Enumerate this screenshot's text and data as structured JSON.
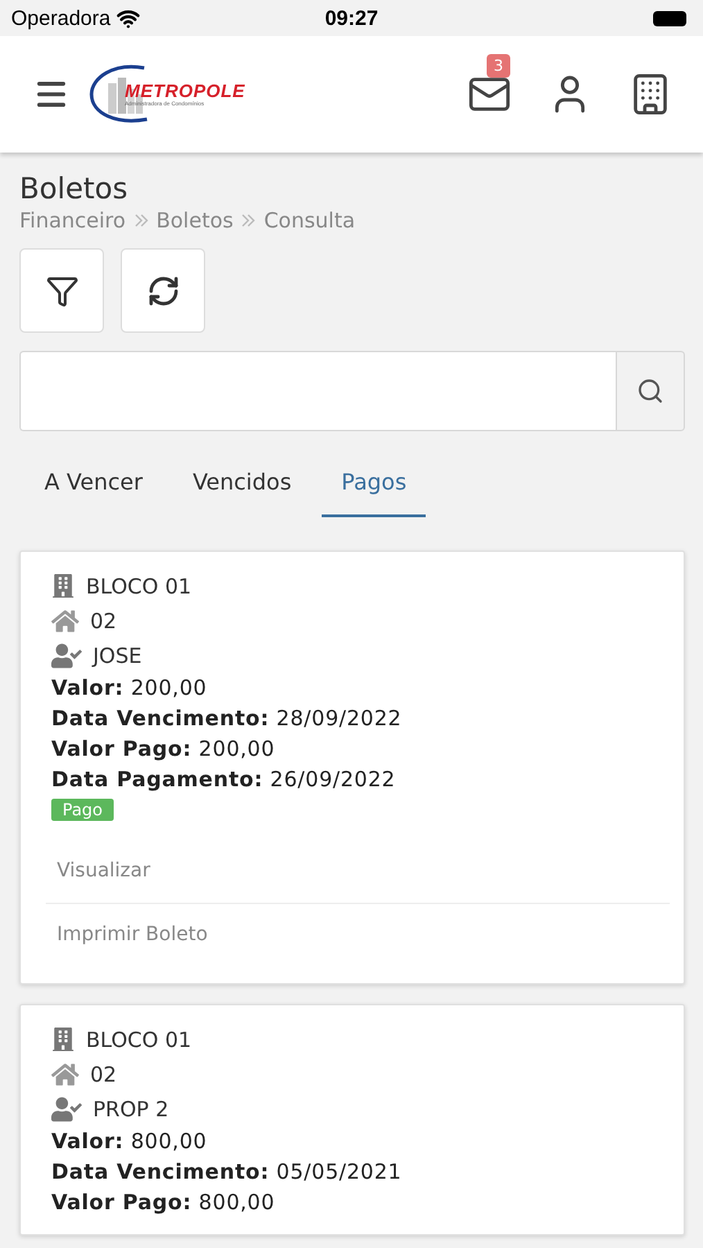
{
  "status_bar": {
    "carrier": "Operadora",
    "time": "09:27"
  },
  "header": {
    "logo": {
      "name": "METROPOLE",
      "tagline": "Administradora de Condomínios"
    },
    "mail_badge": "3"
  },
  "page": {
    "title": "Boletos",
    "breadcrumb": [
      "Financeiro",
      "Boletos",
      "Consulta"
    ]
  },
  "tabs": [
    {
      "label": "A Vencer",
      "selected": false
    },
    {
      "label": "Vencidos",
      "selected": false
    },
    {
      "label": "Pagos",
      "selected": true
    }
  ],
  "cards": [
    {
      "block": "BLOCO 01",
      "unit": "02",
      "owner": "JOSE",
      "fields": [
        "**Valor:** 200,00",
        "**Data Vencimento:** 28/09/2022",
        "**Valor Pago:** 200,00",
        "**Data Pagamento:** 26/09/2022"
      ],
      "status": "Pago",
      "actions": [
        "Visualizar",
        "Imprimir Boleto"
      ]
    },
    {
      "block": "BLOCO 01",
      "unit": "02",
      "owner": "PROP 2",
      "fields": [
        "**Valor:** 800,00",
        "**Data Vencimento:** 05/05/2021",
        "**Valor Pago:** 800,00"
      ]
    }
  ]
}
